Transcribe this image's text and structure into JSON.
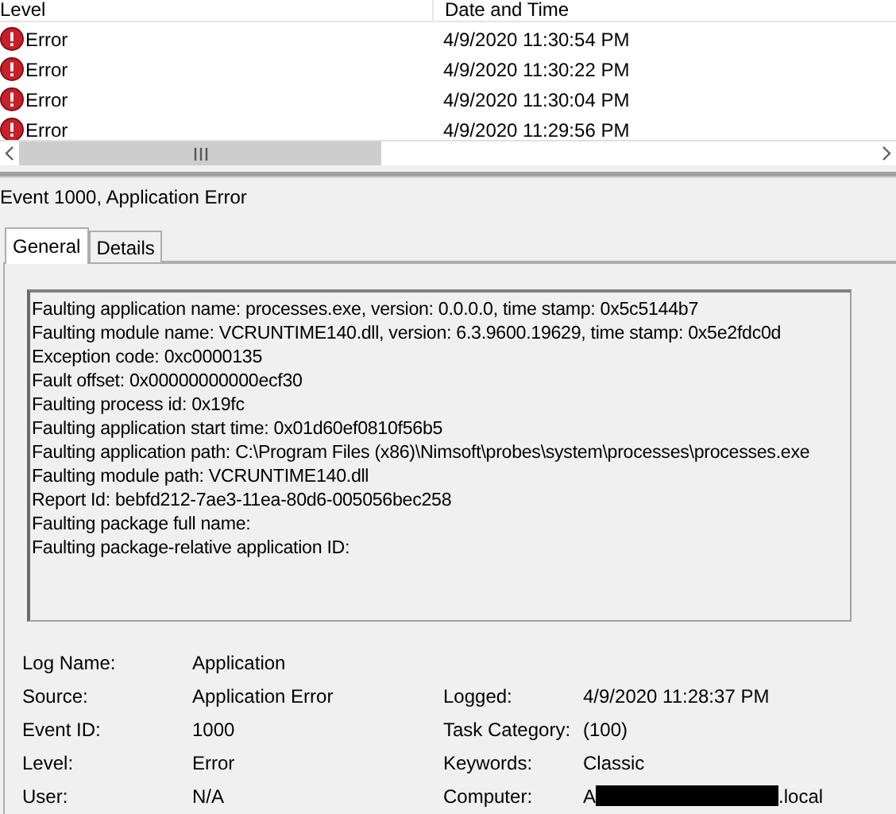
{
  "event_list": {
    "columns": [
      "Level",
      "Date and Time"
    ],
    "rows": [
      {
        "level": "Error",
        "date_time": "4/9/2020 11:30:54 PM"
      },
      {
        "level": "Error",
        "date_time": "4/9/2020 11:30:22 PM"
      },
      {
        "level": "Error",
        "date_time": "4/9/2020 11:30:04 PM"
      },
      {
        "level": "Error",
        "date_time": "4/9/2020 11:29:56 PM"
      }
    ]
  },
  "detail": {
    "title": "Event 1000, Application Error",
    "tabs": [
      {
        "label": "General",
        "selected": true
      },
      {
        "label": "Details",
        "selected": false
      }
    ],
    "description": [
      "Faulting application name: processes.exe, version: 0.0.0.0, time stamp: 0x5c5144b7",
      "Faulting module name: VCRUNTIME140.dll, version: 6.3.9600.19629, time stamp: 0x5e2fdc0d",
      "Exception code: 0xc0000135",
      "Fault offset: 0x00000000000ecf30",
      "Faulting process id: 0x19fc",
      "Faulting application start time: 0x01d60ef0810f56b5",
      "Faulting application path: C:\\Program Files (x86)\\Nimsoft\\probes\\system\\processes\\processes.exe",
      "Faulting module path: VCRUNTIME140.dll",
      "Report Id: bebfd212-7ae3-11ea-80d6-005056bec258",
      "Faulting package full name:",
      "Faulting package-relative application ID:"
    ],
    "fields_left": [
      {
        "label": "Log Name:",
        "value": "Application"
      },
      {
        "label": "Source:",
        "value": "Application Error"
      },
      {
        "label": "Event ID:",
        "value": "1000"
      },
      {
        "label": "Level:",
        "value": "Error"
      },
      {
        "label": "User:",
        "value": "N/A"
      }
    ],
    "fields_right": [
      {
        "label": "Logged:",
        "value": "4/9/2020 11:28:37 PM"
      },
      {
        "label": "Task Category:",
        "value": "(100)"
      },
      {
        "label": "Keywords:",
        "value": "Classic"
      },
      {
        "label": "Computer:",
        "value": "A",
        "redacted": true,
        "value_suffix": ".local"
      }
    ]
  }
}
